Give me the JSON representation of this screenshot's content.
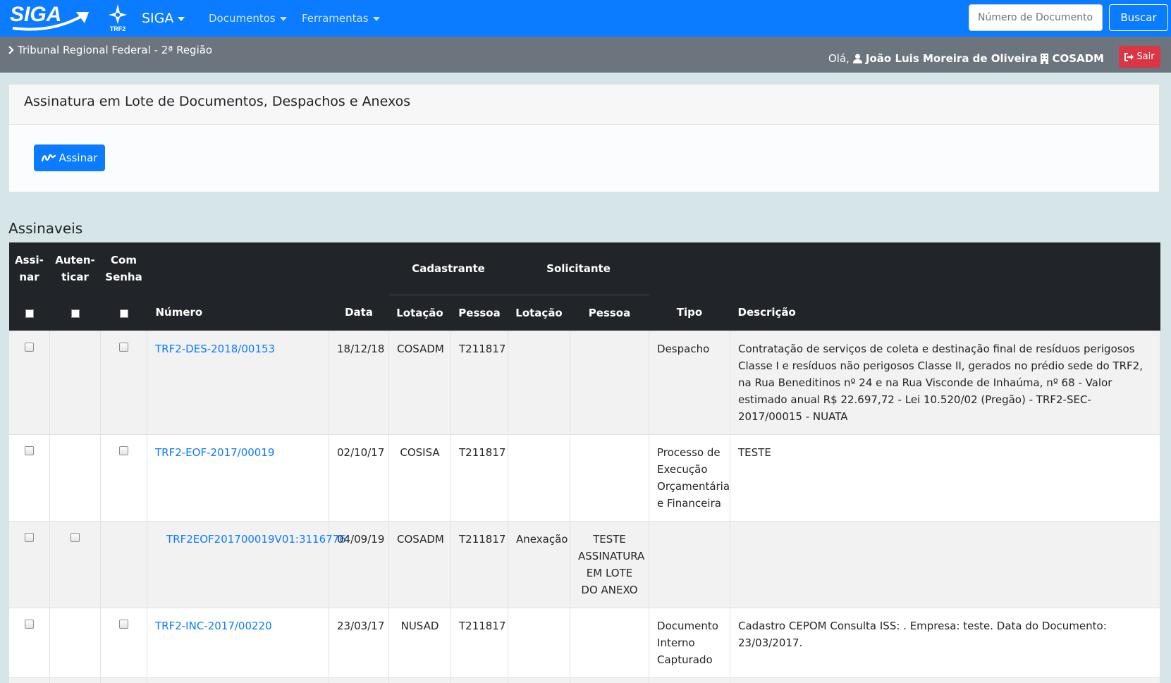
{
  "header": {
    "logo_text": "SIGA",
    "trf_logo_text": "TRF2",
    "nav": {
      "siga": "SIGA",
      "documentos": "Documentos",
      "ferramentas": "Ferramentas"
    },
    "search_placeholder": "Número de Documento",
    "search_button": "Buscar"
  },
  "subbar": {
    "breadcrumb": "Tribunal Regional Federal - 2ª Região",
    "greeting": "Olá,",
    "user_name": "João Luis Moreira de Oliveira",
    "lotacao": "COSADM",
    "logout": "Sair"
  },
  "card": {
    "title": "Assinatura em Lote de Documentos, Despachos e Anexos",
    "sign_button": "Assinar"
  },
  "section_title": "Assinaveis",
  "table": {
    "headers": {
      "assinar_1": "Assi-",
      "assinar_2": "nar",
      "autenticar_1": "Auten-",
      "autenticar_2": "ticar",
      "com_senha_1": "Com",
      "com_senha_2": "Senha",
      "cadastrante": "Cadastrante",
      "solicitante": "Solicitante",
      "numero": "Número",
      "data": "Data",
      "cad_lotacao": "Lotação",
      "cad_pessoa": "Pessoa",
      "sol_lotacao": "Lotação",
      "sol_pessoa": "Pessoa",
      "tipo": "Tipo",
      "descricao": "Descrição"
    },
    "rows": [
      {
        "numero": "TRF2-DES-2018/00153",
        "data": "18/12/18",
        "cad_lotacao": "COSADM",
        "cad_pessoa": "T211817",
        "sol_lotacao": "",
        "sol_pessoa": "",
        "tipo": "Despacho",
        "descricao": "Contratação de serviços de coleta e destinação final de resíduos perigosos Classe I e resíduos não perigosos Classe II, gerados no prédio sede do TRF2, na Rua Beneditinos nº 24 e na Rua Visconde de Inhaúma, nº 68 - Valor estimado anual R$ 22.697,72 - Lei 10.520/02 (Pregão) - TRF2-SEC-2017/00015 - NUATA"
      },
      {
        "numero": "TRF2-EOF-2017/00019",
        "data": "02/10/17",
        "cad_lotacao": "COSISA",
        "cad_pessoa": "T211817",
        "sol_lotacao": "",
        "sol_pessoa": "",
        "tipo": "Processo de Execução Orçamentária e Financeira",
        "descricao": "TESTE"
      },
      {
        "numero": "TRF2EOF201700019V01:3116776",
        "data": "04/09/19",
        "cad_lotacao": "COSADM",
        "cad_pessoa": "T211817",
        "sol_lotacao": "Anexação",
        "sol_pessoa": "TESTE ASSINATURA EM LOTE DO ANEXO",
        "tipo": "",
        "descricao": ""
      },
      {
        "numero": "TRF2-INC-2017/00220",
        "data": "23/03/17",
        "cad_lotacao": "NUSAD",
        "cad_pessoa": "T211817",
        "sol_lotacao": "",
        "sol_pessoa": "",
        "tipo": "Documento Interno Capturado",
        "descricao": "Cadastro CEPOM Consulta ISS: . Empresa: teste. Data do Documento: 23/03/2017."
      }
    ]
  },
  "colors": {
    "primary": "#0b7bff",
    "subbar": "#6c757d",
    "danger": "#dc3545",
    "table_header": "#212529",
    "page_bg": "#d6e6e8"
  }
}
